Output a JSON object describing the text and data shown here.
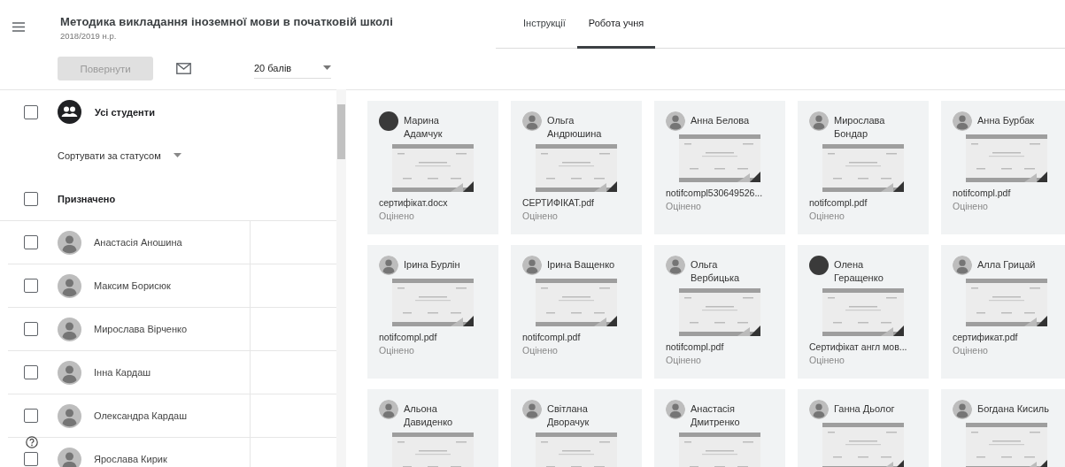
{
  "header": {
    "title": "Методика викладання іноземної мови в початковій школі",
    "subtitle": "2018/2019 н.р."
  },
  "tabs": [
    {
      "label": "Інструкції",
      "selected": false
    },
    {
      "label": "Робота учня",
      "selected": true
    }
  ],
  "toolbar": {
    "return_button": {
      "label": "Повернути",
      "disabled": true
    },
    "points_select": {
      "value": "20 балів"
    }
  },
  "roster": {
    "all_students": {
      "label": "Усі студенти",
      "checked": false
    },
    "sort": {
      "label": "Сортувати за статусом"
    },
    "group": {
      "label": "Призначено",
      "checked": false
    },
    "students": [
      {
        "name": "Анастасія Аношина",
        "checked": false
      },
      {
        "name": "Максим Борисюк",
        "checked": false
      },
      {
        "name": "Мирослава Вірченко",
        "checked": false
      },
      {
        "name": "Інна Кардаш",
        "checked": false
      },
      {
        "name": "Олександра Кардаш",
        "checked": false
      },
      {
        "name": "Ярослава Кирик",
        "checked": false
      }
    ]
  },
  "submissions": [
    {
      "name": "Марина Адамчук",
      "kind": "photo",
      "file": "сертифікат.docx",
      "status": "Оцінено"
    },
    {
      "name": "Ольга Андрюшина",
      "kind": "default",
      "file": "СЕРТИФІКАТ.pdf",
      "status": "Оцінено"
    },
    {
      "name": "Анна Белова",
      "kind": "default",
      "file": "notifcompl530649526...",
      "status": "Оцінено"
    },
    {
      "name": "Мирослава Бондар",
      "kind": "default",
      "file": "notifcompl.pdf",
      "status": "Оцінено"
    },
    {
      "name": "Анна Бурбак",
      "kind": "default",
      "file": "notifcompl.pdf",
      "status": "Оцінено"
    },
    {
      "name": "Ірина Бурлін",
      "kind": "default",
      "file": "notifcompl.pdf",
      "status": "Оцінено"
    },
    {
      "name": "Ірина Ващенко",
      "kind": "default",
      "file": "notifcompl.pdf",
      "status": "Оцінено"
    },
    {
      "name": "Ольга Вербицька",
      "kind": "default",
      "file": "notifcompl.pdf",
      "status": "Оцінено"
    },
    {
      "name": "Олена Геращенко",
      "kind": "photo",
      "file": "Сертифікат англ мов...",
      "status": "Оцінено"
    },
    {
      "name": "Алла Грицай",
      "kind": "default",
      "file": "сертификат.pdf",
      "status": "Оцінено"
    },
    {
      "name": "Альона Давиденко",
      "kind": "default"
    },
    {
      "name": "Світлана Дворачук",
      "kind": "default"
    },
    {
      "name": "Анастасія Дмитренко",
      "kind": "default"
    },
    {
      "name": "Ганна Дьолог",
      "kind": "default"
    },
    {
      "name": "Богдана Кисиль",
      "kind": "default"
    }
  ]
}
